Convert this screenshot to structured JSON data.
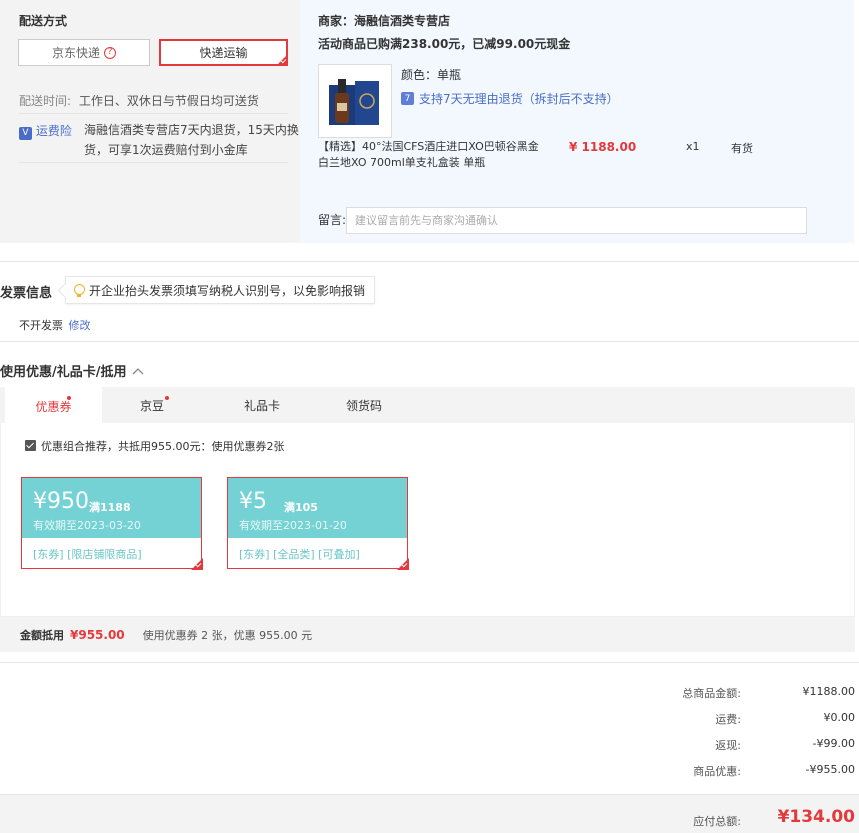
{
  "shipping": {
    "title": "配送方式",
    "options": [
      {
        "label": "京东快递",
        "help": "?"
      },
      {
        "label": "快递运输"
      }
    ],
    "time_label": "配送时间:",
    "time_value": "工作日、双休日与节假日均可送货",
    "insurance_icon": "V",
    "insurance_label": "运费险",
    "insurance_text_1": "海融信酒类专营店7天内退货，15天内换",
    "insurance_text_2": "货，可享1次运费赔付到小金库"
  },
  "shop": {
    "merchant": "商家：海融信酒类专营店",
    "promo": "活动商品已购满238.00元，已减99.00元现金",
    "color_label": "颜色：单瓶",
    "return_icon": "7",
    "return_text": "支持7天无理由退货（拆封后不支持）",
    "product_name_1": "【精选】40°法国CFS酒庄进口XO巴顿谷黑金",
    "product_name_2": "白兰地XO 700ml单支礼盒装 单瓶",
    "price": "¥ 1188.00",
    "qty": "x1",
    "stock": "有货",
    "message_label": "留言:",
    "message_placeholder": "建议留言前先与商家沟通确认"
  },
  "invoice": {
    "title": "发票信息",
    "tip": "开企业抬头发票须填写纳税人识别号，以免影响报销",
    "status": "不开发票",
    "edit": "修改"
  },
  "discount": {
    "title": "使用优惠/礼品卡/抵用",
    "tabs": [
      {
        "label": "优惠券",
        "dot": true,
        "active": true
      },
      {
        "label": "京豆",
        "dot": true,
        "active": false
      },
      {
        "label": "礼品卡",
        "dot": false,
        "active": false
      },
      {
        "label": "领货码",
        "dot": false,
        "active": false
      }
    ],
    "recommend": "优惠组合推荐，共抵用955.00元：使用优惠券2张",
    "coupons": [
      {
        "amount": "¥950",
        "cond": "满1188",
        "expire": "有效期至2023-03-20",
        "tags": "[东券]  [限店铺限商品]"
      },
      {
        "amount": "¥5",
        "cond": "满105",
        "expire": "有效期至2023-01-20",
        "tags": "[东券]  [全品类]  [可叠加]"
      }
    ],
    "deduct_label": "金额抵用",
    "deduct_value": "¥955.00",
    "deduct_desc": "使用优惠券 2 张，优惠 955.00 元"
  },
  "summary": {
    "rows": [
      {
        "label": "总商品金额:",
        "value": "¥1188.00"
      },
      {
        "label": "运费:",
        "value": "¥0.00"
      },
      {
        "label": "返现:",
        "value": "-¥99.00"
      },
      {
        "label": "商品优惠:",
        "value": "-¥955.00"
      }
    ],
    "pay_label": "应付总额:",
    "pay_value": "¥134.00"
  },
  "colors": {
    "accent": "#e4393c",
    "coupon": "#74d2d4",
    "link": "#4a6ec8"
  }
}
